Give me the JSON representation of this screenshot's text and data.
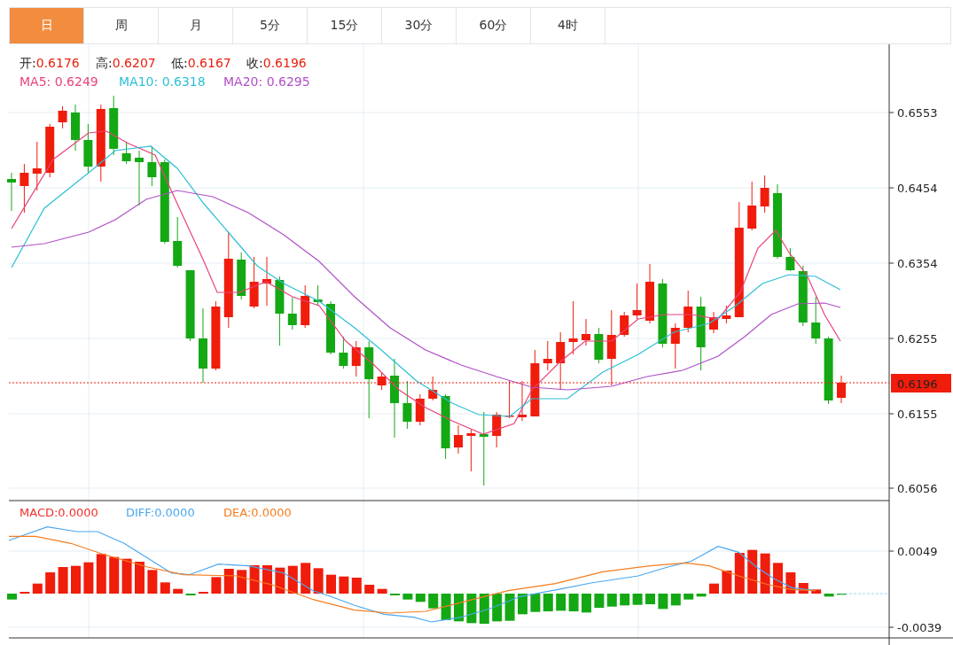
{
  "tabs": [
    {
      "label": "日",
      "selected": true
    },
    {
      "label": "周",
      "selected": false
    },
    {
      "label": "月",
      "selected": false
    },
    {
      "label": "5分",
      "selected": false
    },
    {
      "label": "15分",
      "selected": false
    },
    {
      "label": "30分",
      "selected": false
    },
    {
      "label": "60分",
      "selected": false
    },
    {
      "label": "4时",
      "selected": false
    }
  ],
  "ohlc": [
    {
      "label": "开:",
      "value": "0.6176"
    },
    {
      "label": "高:",
      "value": "0.6207"
    },
    {
      "label": "低:",
      "value": "0.6167"
    },
    {
      "label": "收:",
      "value": "0.6196"
    }
  ],
  "moving_averages": [
    {
      "label": "MA5:",
      "value": "0.6249",
      "color": "#e8427c"
    },
    {
      "label": "MA10:",
      "value": "0.6318",
      "color": "#2cbfd6"
    },
    {
      "label": "MA20:",
      "value": "0.6295",
      "color": "#b04fc6"
    }
  ],
  "price_axis": {
    "ticks": [
      "0.6553",
      "0.6454",
      "0.6354",
      "0.6255",
      "0.6155",
      "0.6056"
    ],
    "current_price": "0.6196"
  },
  "macd_legend": [
    {
      "label": "MACD:",
      "value": "0.0000",
      "color": "#f0302a"
    },
    {
      "label": "DIFF:",
      "value": "0.0000",
      "color": "#4aa8f0"
    },
    {
      "label": "DEA:",
      "value": "0.0000",
      "color": "#f57d1f"
    }
  ],
  "macd_axis": {
    "ticks": [
      "0.0049",
      "-0.0039"
    ]
  }
}
